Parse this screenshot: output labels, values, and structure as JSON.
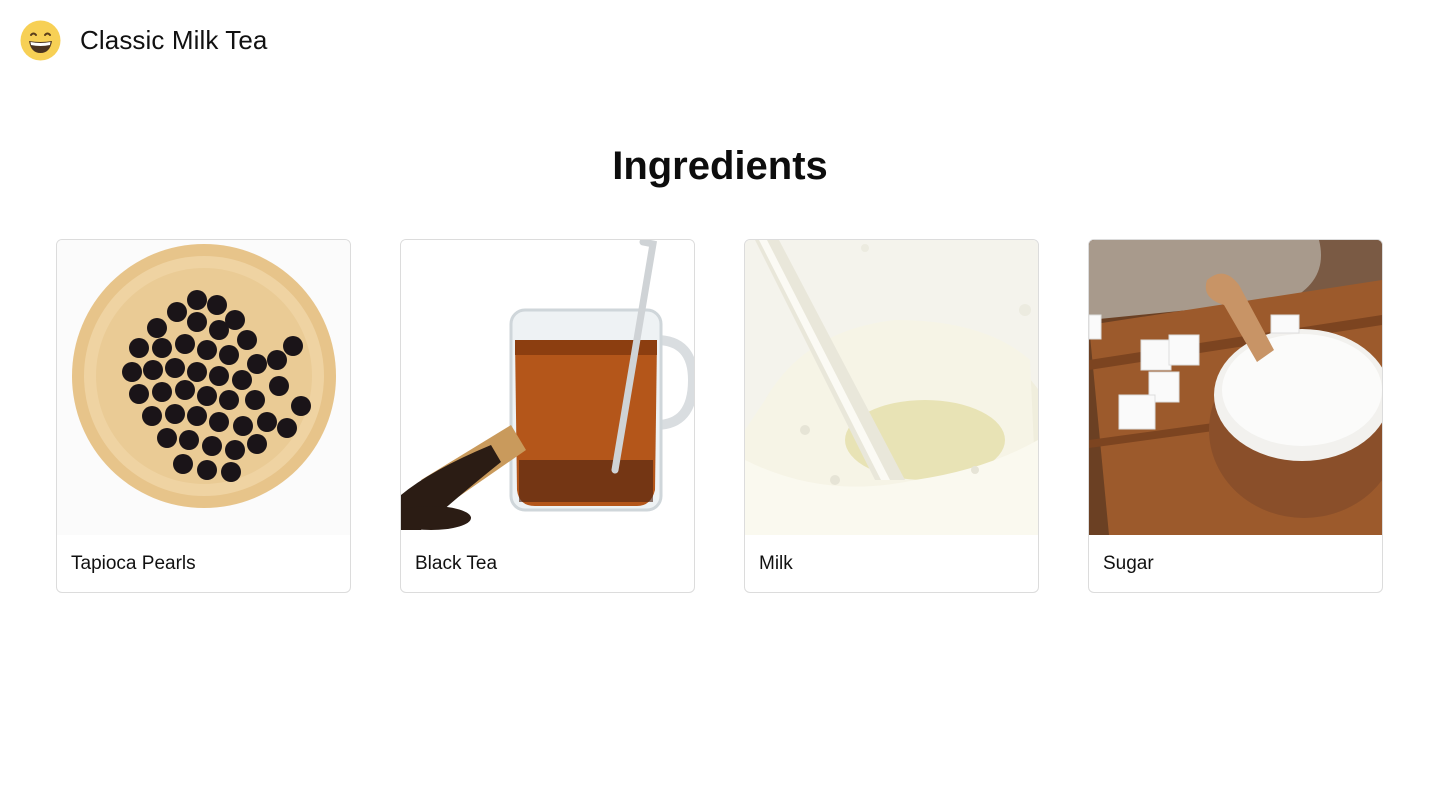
{
  "header": {
    "logo_icon": "grinning-face-icon",
    "title": "Classic Milk Tea"
  },
  "section": {
    "title": "Ingredients"
  },
  "ingredients": [
    {
      "name": "Tapioca Pearls",
      "image": "tapioca-pearls-image"
    },
    {
      "name": "Black Tea",
      "image": "black-tea-image"
    },
    {
      "name": "Milk",
      "image": "milk-splash-image"
    },
    {
      "name": "Sugar",
      "image": "sugar-bowl-image"
    }
  ],
  "colors": {
    "card_border": "#dcdcdc",
    "logo_yellow": "#f7d055"
  }
}
